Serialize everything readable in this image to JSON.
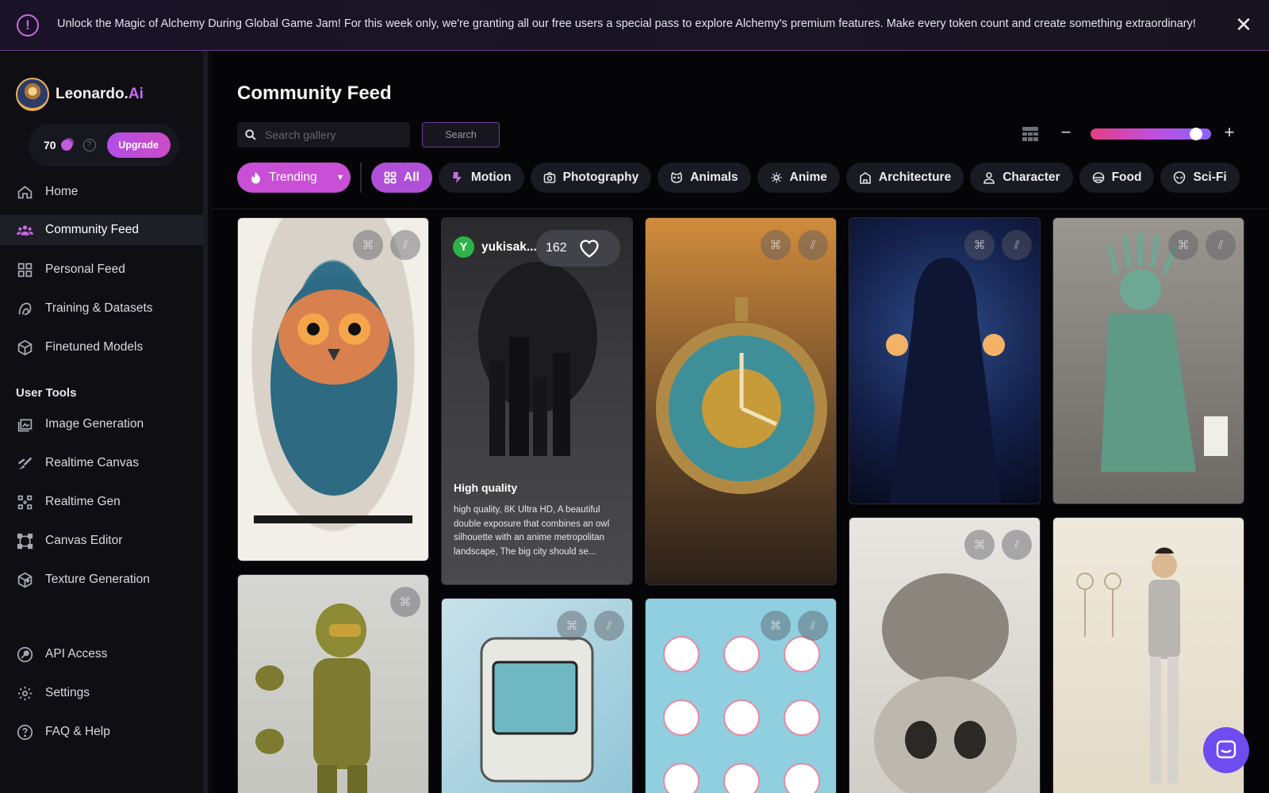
{
  "banner": {
    "text": "Unlock the Magic of Alchemy During Global Game Jam! For this week only, we're granting all our free users a special pass to explore Alchemy's premium features. Make every token count and create something extraordinary!",
    "icon": "!",
    "close": "✕"
  },
  "brand": {
    "name": "Leonardo.",
    "suffix": "Ai"
  },
  "tokens": {
    "count": "70",
    "upgrade_label": "Upgrade"
  },
  "nav": {
    "home": "Home",
    "community_feed": "Community Feed",
    "personal_feed": "Personal Feed",
    "training": "Training & Datasets",
    "finetuned": "Finetuned Models",
    "user_tools_title": "User Tools",
    "image_generation": "Image Generation",
    "realtime_canvas": "Realtime Canvas",
    "realtime_gen": "Realtime Gen",
    "canvas_editor": "Canvas Editor",
    "texture_generation": "Texture Generation",
    "api_access": "API Access",
    "settings": "Settings",
    "faq": "FAQ & Help"
  },
  "main": {
    "title": "Community Feed",
    "search_placeholder": "Search gallery",
    "search_label": "Search",
    "zoom_level": 0.92,
    "zoom_minus": "−",
    "zoom_plus": "+"
  },
  "filters": {
    "trending": "Trending",
    "chips": [
      "All",
      "Motion",
      "Photography",
      "Animals",
      "Anime",
      "Architecture",
      "Character",
      "Food",
      "Sci-Fi"
    ],
    "active": "All"
  },
  "feed": {
    "hover_card": {
      "user_initial": "Y",
      "username": "yukisak...",
      "likes": "162",
      "quality": "High quality",
      "prompt": "high quality, 8K Ultra HD, A beautiful double exposure that combines an owl silhouette with an anime metropolitan landscape, The big city should se..."
    },
    "cards": [
      "owl painting",
      "armored soldier reference sheet",
      "owl city double exposure",
      "retro handheld device",
      "steampunk pocket watch",
      "bunny sticker sheet",
      "cosmic hooded figure",
      "cat on skull sketch",
      "statue of liberty smoking",
      "character concept sheet"
    ]
  },
  "colors": {
    "accent": "#c84fd6",
    "active_chip": "#b04fd8",
    "chat": "#6d4cf0"
  }
}
